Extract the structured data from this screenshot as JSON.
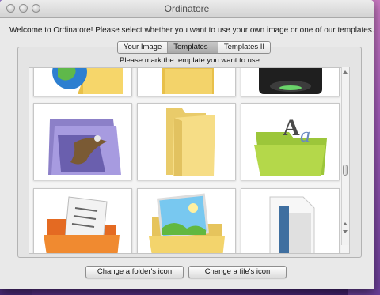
{
  "window": {
    "title": "Ordinatore"
  },
  "welcome": {
    "text": "Welcome to Ordinatore! Please select whether you want to use your own image or one of our templates."
  },
  "tabs": [
    {
      "label": "Your Image",
      "active": false
    },
    {
      "label": "Templates I",
      "active": true
    },
    {
      "label": "Templates II",
      "active": false
    }
  ],
  "panel": {
    "instruction": "Please mark the template you want to use"
  },
  "templates": [
    {
      "icon": "globe-folder-icon"
    },
    {
      "icon": "yellow-folder-icon"
    },
    {
      "icon": "dark-device-icon"
    },
    {
      "icon": "bird-photo-folder-icon"
    },
    {
      "icon": "open-yellow-folder-icon"
    },
    {
      "icon": "font-green-folder-icon"
    },
    {
      "icon": "music-orange-folder-icon"
    },
    {
      "icon": "picture-folder-icon"
    },
    {
      "icon": "white-document-icon"
    }
  ],
  "buttons": {
    "change_folder_icon": "Change a folder's icon",
    "change_file_icon": "Change a file's icon"
  },
  "colors": {
    "window_background": "#e9e9e9",
    "active_tab": "#b5b5b5",
    "desktop": "#6b3f9a"
  }
}
